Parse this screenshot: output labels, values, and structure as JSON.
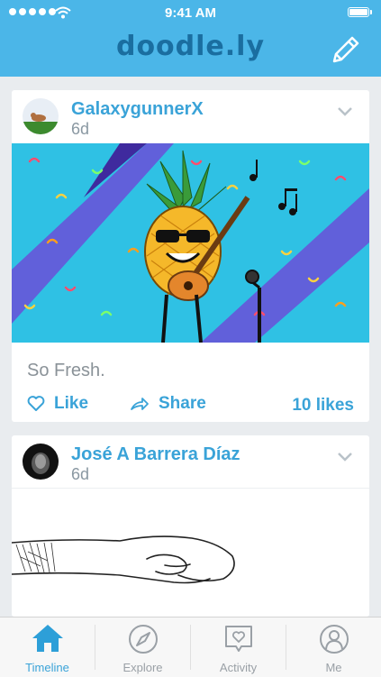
{
  "status_bar": {
    "time": "9:41 AM"
  },
  "app": {
    "title": "doodle.ly"
  },
  "posts": [
    {
      "author": "GalaxygunnerX",
      "age": "6d",
      "caption": "So Fresh.",
      "like_label": "Like",
      "share_label": "Share",
      "likes_count": "10 likes"
    },
    {
      "author": "José A Barrera Díaz",
      "age": "6d"
    }
  ],
  "tabs": [
    {
      "label": "Timeline",
      "icon": "home-icon",
      "active": true
    },
    {
      "label": "Explore",
      "icon": "compass-icon",
      "active": false
    },
    {
      "label": "Activity",
      "icon": "heart-bubble-icon",
      "active": false
    },
    {
      "label": "Me",
      "icon": "user-icon",
      "active": false
    }
  ],
  "colors": {
    "header_bg": "#4bb6e8",
    "accent": "#3aa3d8",
    "page_bg": "#e9ecef"
  }
}
